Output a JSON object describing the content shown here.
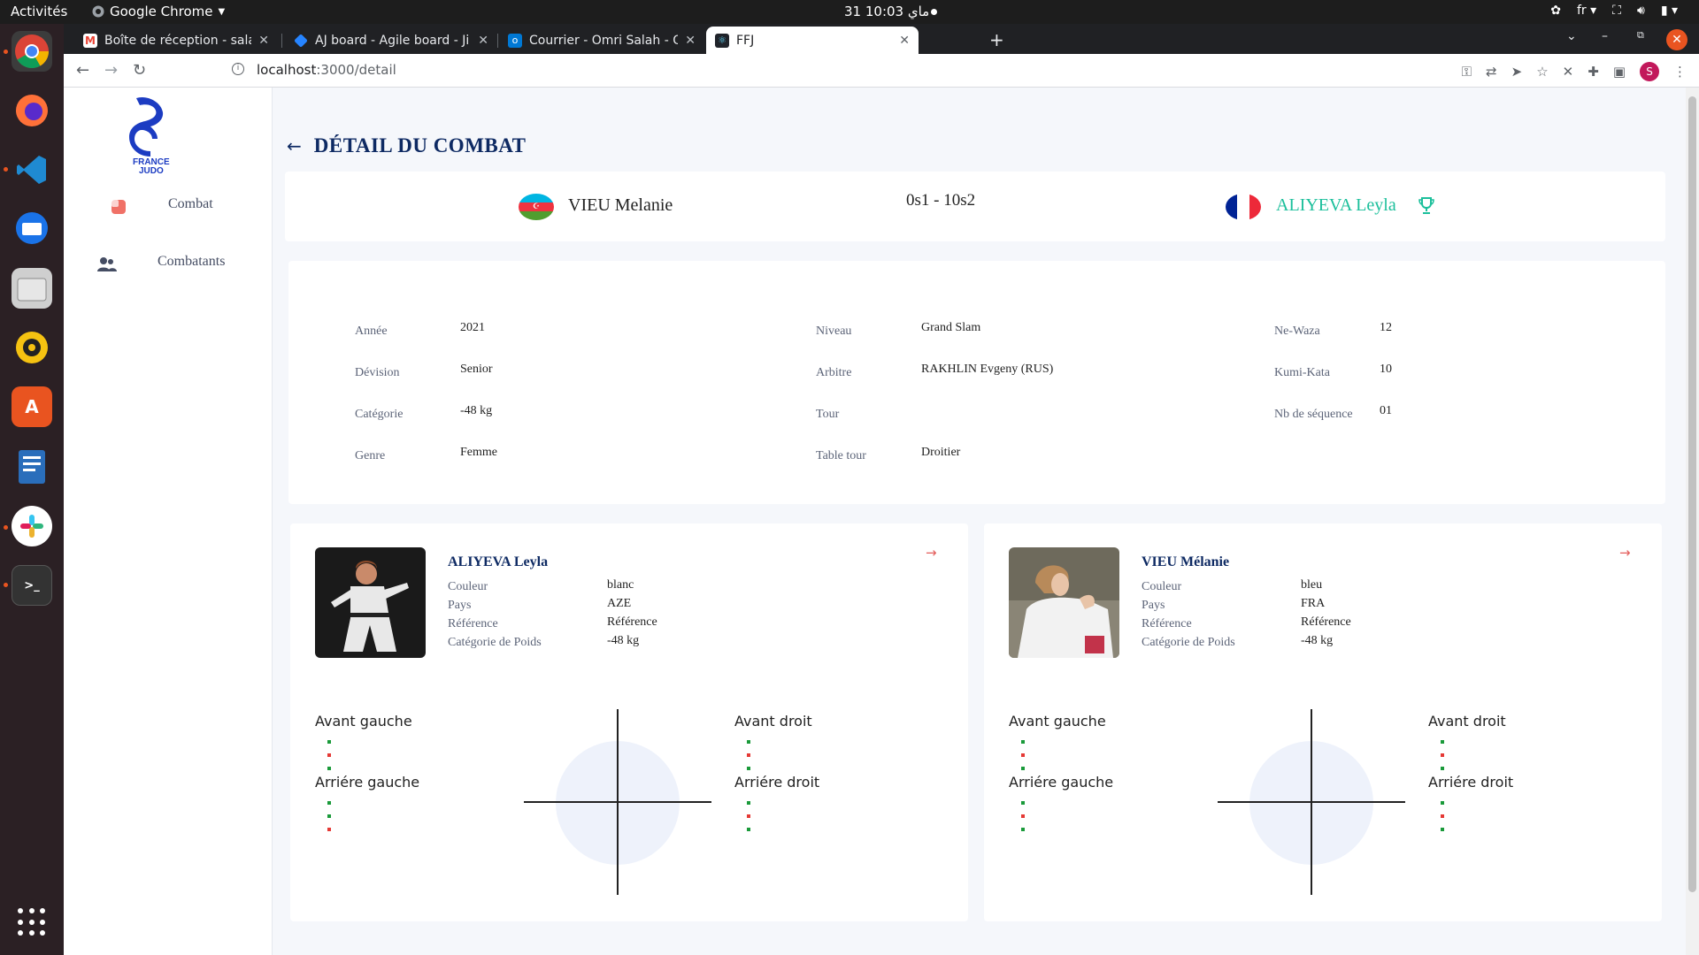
{
  "os": {
    "activities": "Activités",
    "app_name": "Google Chrome",
    "clock": "31 ماي 10:03",
    "lang": "fr"
  },
  "browser": {
    "tabs": [
      {
        "title": "Boîte de réception - salah",
        "color": "#ea4335"
      },
      {
        "title": "AJ board - Agile board - Ji",
        "color": "#2684ff"
      },
      {
        "title": "Courrier - Omri Salah - Ou",
        "color": "#0078d4"
      },
      {
        "title": "FFJ",
        "color": "#20232a"
      }
    ],
    "url_host": "localhost",
    "url_path": ":3000/detail",
    "profile_initial": "S"
  },
  "sidebar": {
    "logo_text": "FRANCE\nJUDO",
    "items": [
      {
        "label": "Combat"
      },
      {
        "label": "Combatants"
      }
    ]
  },
  "page": {
    "title": "DÉTAIL DU COMBAT"
  },
  "score_card": {
    "left_name": "VIEU Melanie",
    "score": "0s1 - 10s2",
    "right_name": "ALIYEVA Leyla",
    "winner_color": "#1bbf9b"
  },
  "info": {
    "col1": [
      {
        "label": "Année",
        "value": "2021"
      },
      {
        "label": "Dévision",
        "value": "Senior"
      },
      {
        "label": "Catégorie",
        "value": "-48 kg"
      },
      {
        "label": "Genre",
        "value": "Femme"
      }
    ],
    "col2": [
      {
        "label": "Niveau",
        "value": "Grand Slam"
      },
      {
        "label": "Arbitre",
        "value": "RAKHLIN Evgeny (RUS)"
      },
      {
        "label": "Tour",
        "value": ""
      },
      {
        "label": "Table tour",
        "value": "Droitier"
      }
    ],
    "col3": [
      {
        "label": "Ne-Waza",
        "value": "12"
      },
      {
        "label": "Kumi-Kata",
        "value": "10"
      },
      {
        "label": "Nb de séquence",
        "value": "01"
      }
    ]
  },
  "fighters": [
    {
      "name": "ALIYEVA Leyla",
      "fields": [
        {
          "label": "Couleur",
          "value": "blanc"
        },
        {
          "label": "Pays",
          "value": "AZE"
        },
        {
          "label": "Référence",
          "value": "Référence"
        },
        {
          "label": "Catégorie de Poids",
          "value": "-48 kg"
        }
      ],
      "quad": {
        "front_left": "Avant gauche",
        "front_right": "Avant droit",
        "back_left": "Arriére gauche",
        "back_right": "Arriére droit"
      }
    },
    {
      "name": "VIEU Mélanie",
      "fields": [
        {
          "label": "Couleur",
          "value": "bleu"
        },
        {
          "label": "Pays",
          "value": "FRA"
        },
        {
          "label": "Référence",
          "value": "Référence"
        },
        {
          "label": "Catégorie de Poids",
          "value": "-48 kg"
        }
      ],
      "quad": {
        "front_left": "Avant gauche",
        "front_right": "Avant droit",
        "back_left": "Arriére gauche",
        "back_right": "Arriére droit"
      }
    }
  ]
}
